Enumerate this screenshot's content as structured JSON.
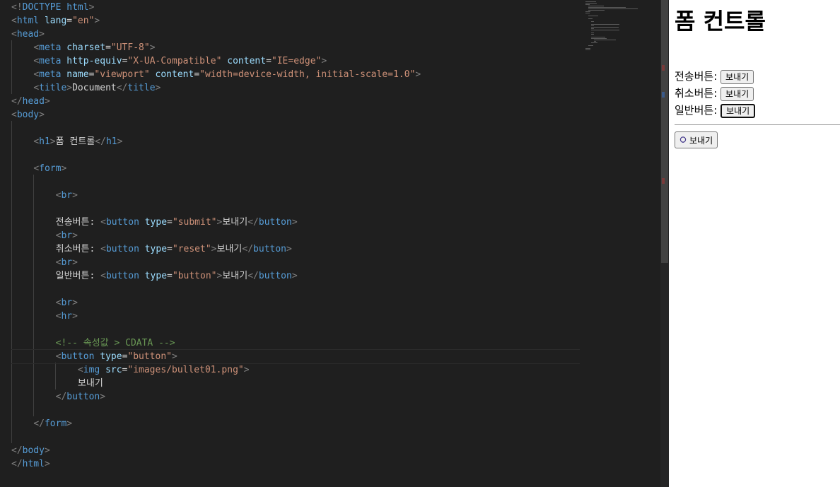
{
  "editor": {
    "lines": [
      [
        [
          "bracket",
          "<!"
        ],
        [
          "tag",
          "DOCTYPE html"
        ],
        [
          "bracket",
          ">"
        ]
      ],
      [
        [
          "bracket",
          "<"
        ],
        [
          "tag",
          "html "
        ],
        [
          "attr",
          "lang"
        ],
        [
          "text",
          "="
        ],
        [
          "str",
          "\"en\""
        ],
        [
          "bracket",
          ">"
        ]
      ],
      [
        [
          "bracket",
          "<"
        ],
        [
          "tag",
          "head"
        ],
        [
          "bracket",
          ">"
        ]
      ],
      [
        [
          "text",
          "    "
        ],
        [
          "bracket",
          "<"
        ],
        [
          "tag",
          "meta "
        ],
        [
          "attr",
          "charset"
        ],
        [
          "text",
          "="
        ],
        [
          "str",
          "\"UTF-8\""
        ],
        [
          "bracket",
          ">"
        ]
      ],
      [
        [
          "text",
          "    "
        ],
        [
          "bracket",
          "<"
        ],
        [
          "tag",
          "meta "
        ],
        [
          "attr",
          "http-equiv"
        ],
        [
          "text",
          "="
        ],
        [
          "str",
          "\"X-UA-Compatible\""
        ],
        [
          "text",
          " "
        ],
        [
          "attr",
          "content"
        ],
        [
          "text",
          "="
        ],
        [
          "str",
          "\"IE=edge\""
        ],
        [
          "bracket",
          ">"
        ]
      ],
      [
        [
          "text",
          "    "
        ],
        [
          "bracket",
          "<"
        ],
        [
          "tag",
          "meta "
        ],
        [
          "attr",
          "name"
        ],
        [
          "text",
          "="
        ],
        [
          "str",
          "\"viewport\""
        ],
        [
          "text",
          " "
        ],
        [
          "attr",
          "content"
        ],
        [
          "text",
          "="
        ],
        [
          "str",
          "\"width=device-width, initial-scale=1.0\""
        ],
        [
          "bracket",
          ">"
        ]
      ],
      [
        [
          "text",
          "    "
        ],
        [
          "bracket",
          "<"
        ],
        [
          "tag",
          "title"
        ],
        [
          "bracket",
          ">"
        ],
        [
          "text",
          "Document"
        ],
        [
          "bracket",
          "</"
        ],
        [
          "tag",
          "title"
        ],
        [
          "bracket",
          ">"
        ]
      ],
      [
        [
          "bracket",
          "</"
        ],
        [
          "tag",
          "head"
        ],
        [
          "bracket",
          ">"
        ]
      ],
      [
        [
          "bracket",
          "<"
        ],
        [
          "tag",
          "body"
        ],
        [
          "bracket",
          ">"
        ]
      ],
      [],
      [
        [
          "text",
          "    "
        ],
        [
          "bracket",
          "<"
        ],
        [
          "tag",
          "h1"
        ],
        [
          "bracket",
          ">"
        ],
        [
          "text",
          "폼 컨트롤"
        ],
        [
          "bracket",
          "</"
        ],
        [
          "tag",
          "h1"
        ],
        [
          "bracket",
          ">"
        ]
      ],
      [],
      [
        [
          "text",
          "    "
        ],
        [
          "bracket",
          "<"
        ],
        [
          "tag",
          "form"
        ],
        [
          "bracket",
          ">"
        ]
      ],
      [],
      [
        [
          "text",
          "        "
        ],
        [
          "bracket",
          "<"
        ],
        [
          "tag",
          "br"
        ],
        [
          "bracket",
          ">"
        ]
      ],
      [],
      [
        [
          "text",
          "        전송버튼: "
        ],
        [
          "bracket",
          "<"
        ],
        [
          "tag",
          "button "
        ],
        [
          "attr",
          "type"
        ],
        [
          "text",
          "="
        ],
        [
          "str",
          "\"submit\""
        ],
        [
          "bracket",
          ">"
        ],
        [
          "text",
          "보내기"
        ],
        [
          "bracket",
          "</"
        ],
        [
          "tag",
          "button"
        ],
        [
          "bracket",
          ">"
        ]
      ],
      [
        [
          "text",
          "        "
        ],
        [
          "bracket",
          "<"
        ],
        [
          "tag",
          "br"
        ],
        [
          "bracket",
          ">"
        ]
      ],
      [
        [
          "text",
          "        취소버튼: "
        ],
        [
          "bracket",
          "<"
        ],
        [
          "tag",
          "button "
        ],
        [
          "attr",
          "type"
        ],
        [
          "text",
          "="
        ],
        [
          "str",
          "\"reset\""
        ],
        [
          "bracket",
          ">"
        ],
        [
          "text",
          "보내기"
        ],
        [
          "bracket",
          "</"
        ],
        [
          "tag",
          "button"
        ],
        [
          "bracket",
          ">"
        ]
      ],
      [
        [
          "text",
          "        "
        ],
        [
          "bracket",
          "<"
        ],
        [
          "tag",
          "br"
        ],
        [
          "bracket",
          ">"
        ]
      ],
      [
        [
          "text",
          "        일반버튼: "
        ],
        [
          "bracket",
          "<"
        ],
        [
          "tag",
          "button "
        ],
        [
          "attr",
          "type"
        ],
        [
          "text",
          "="
        ],
        [
          "str",
          "\"button\""
        ],
        [
          "bracket",
          ">"
        ],
        [
          "text",
          "보내기"
        ],
        [
          "bracket",
          "</"
        ],
        [
          "tag",
          "button"
        ],
        [
          "bracket",
          ">"
        ]
      ],
      [],
      [
        [
          "text",
          "        "
        ],
        [
          "bracket",
          "<"
        ],
        [
          "tag",
          "br"
        ],
        [
          "bracket",
          ">"
        ]
      ],
      [
        [
          "text",
          "        "
        ],
        [
          "bracket",
          "<"
        ],
        [
          "tag",
          "hr"
        ],
        [
          "bracket",
          ">"
        ]
      ],
      [],
      [
        [
          "text",
          "        "
        ],
        [
          "comment",
          "<!-- 속성값 > CDATA -->"
        ]
      ],
      [
        [
          "text",
          "        "
        ],
        [
          "bracket",
          "<"
        ],
        [
          "tag",
          "button "
        ],
        [
          "attr",
          "type"
        ],
        [
          "text",
          "="
        ],
        [
          "str",
          "\"button\""
        ],
        [
          "bracket",
          ">"
        ]
      ],
      [
        [
          "text",
          "            "
        ],
        [
          "bracket",
          "<"
        ],
        [
          "tag",
          "img "
        ],
        [
          "attr",
          "src"
        ],
        [
          "text",
          "="
        ],
        [
          "str",
          "\"images/bullet01.png\""
        ],
        [
          "bracket",
          ">"
        ]
      ],
      [
        [
          "text",
          "            보내기"
        ]
      ],
      [
        [
          "text",
          "        "
        ],
        [
          "bracket",
          "</"
        ],
        [
          "tag",
          "button"
        ],
        [
          "bracket",
          ">"
        ]
      ],
      [],
      [
        [
          "text",
          "    "
        ],
        [
          "bracket",
          "</"
        ],
        [
          "tag",
          "form"
        ],
        [
          "bracket",
          ">"
        ]
      ],
      [],
      [
        [
          "bracket",
          "</"
        ],
        [
          "tag",
          "body"
        ],
        [
          "bracket",
          ">"
        ]
      ],
      [
        [
          "bracket",
          "</"
        ],
        [
          "tag",
          "html"
        ],
        [
          "bracket",
          ">"
        ]
      ]
    ]
  },
  "preview": {
    "heading": "폼 컨트롤",
    "rows": [
      {
        "label": "전송버튼: ",
        "button": "보내기"
      },
      {
        "label": "취소버튼: ",
        "button": "보내기"
      },
      {
        "label": "일반버튼: ",
        "button": "보내기"
      }
    ],
    "image_button_label": "보내기",
    "image_button_icon": "bullet-icon"
  },
  "colors": {
    "editor_bg": "#1f1f1f",
    "tag": "#569cd6",
    "attribute": "#9cdcfe",
    "string": "#ce9178",
    "bracket": "#808080",
    "comment": "#6a9955"
  }
}
